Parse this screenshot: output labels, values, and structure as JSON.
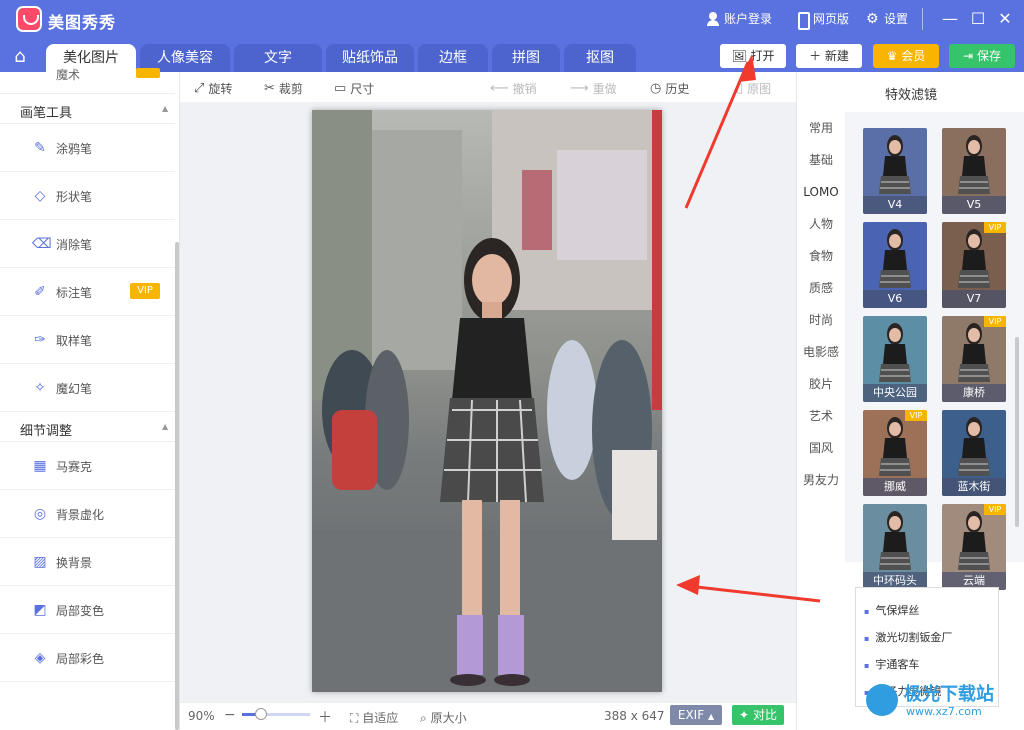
{
  "app": {
    "title": "美图秀秀"
  },
  "titlebar": {
    "login": "账户登录",
    "web": "网页版",
    "settings": "设置"
  },
  "tabs": [
    {
      "label": "美化图片",
      "active": true
    },
    {
      "label": "人像美容"
    },
    {
      "label": "文字"
    },
    {
      "label": "贴纸饰品"
    },
    {
      "label": "边框"
    },
    {
      "label": "拼图"
    },
    {
      "label": "抠图"
    }
  ],
  "actions": {
    "open": "打开",
    "new": "新建",
    "vip": "会员",
    "save": "保存"
  },
  "left": {
    "partial_label": "魔术",
    "sections": [
      {
        "title": "画笔工具",
        "tools": [
          {
            "label": "涂鸦笔",
            "icon": "brush-icon"
          },
          {
            "label": "形状笔",
            "icon": "shape-icon"
          },
          {
            "label": "消除笔",
            "icon": "eraser-icon"
          },
          {
            "label": "标注笔",
            "icon": "marker-icon",
            "vip": "VIP"
          },
          {
            "label": "取样笔",
            "icon": "dropper-icon"
          },
          {
            "label": "魔幻笔",
            "icon": "magic-wand-icon"
          }
        ]
      },
      {
        "title": "细节调整",
        "tools": [
          {
            "label": "马赛克",
            "icon": "mosaic-icon"
          },
          {
            "label": "背景虚化",
            "icon": "blur-icon"
          },
          {
            "label": "换背景",
            "icon": "background-icon"
          },
          {
            "label": "局部变色",
            "icon": "recolor-icon"
          },
          {
            "label": "局部彩色",
            "icon": "colorize-icon"
          }
        ]
      }
    ]
  },
  "toolbar": {
    "rotate": "旋转",
    "crop": "裁剪",
    "size": "尺寸",
    "undo": "撤销",
    "redo": "重做",
    "history": "历史",
    "original": "原图"
  },
  "bottom": {
    "zoom": "90%",
    "zoom_fraction": 0.28,
    "fit": "自适应",
    "original_size": "原大小",
    "dimensions": "388 x 647",
    "exif": "EXIF",
    "compare": "对比"
  },
  "right": {
    "title": "特效滤镜",
    "categories": [
      "常用",
      "基础",
      "LOMO",
      "人物",
      "食物",
      "质感",
      "时尚",
      "电影感",
      "胶片",
      "艺术",
      "国风",
      "男友力"
    ],
    "active_category": "LOMO",
    "filters": [
      {
        "label": "V4",
        "tint": "#5a6fa8"
      },
      {
        "label": "V5",
        "tint": "#8a6f5e",
        "vip": ""
      },
      {
        "label": "V6",
        "tint": "#4b63b3"
      },
      {
        "label": "V7",
        "tint": "#7a5e4e",
        "vip": "VIP"
      },
      {
        "label": "中央公园",
        "tint": "#5c8ea6"
      },
      {
        "label": "康桥",
        "tint": "#8f7a6a",
        "vip": "VIP"
      },
      {
        "label": "挪威",
        "tint": "#9c7158",
        "vip": "VIP"
      },
      {
        "label": "蓝木街",
        "tint": "#3d5f8c"
      },
      {
        "label": "中环码头",
        "tint": "#6a8da0"
      },
      {
        "label": "云端",
        "tint": "#a18b7c",
        "vip": "VIP"
      }
    ],
    "ads": [
      "气保焊丝",
      "激光切割钣金厂",
      "宇通客车",
      "原子力显微镜"
    ]
  },
  "watermark": {
    "title": "极光下载站",
    "url": "www.xz7.com"
  },
  "colors": {
    "brand": "#5a72e0",
    "vip": "#f7b500",
    "save": "#35c46a",
    "arrow": "#f03a2e"
  }
}
